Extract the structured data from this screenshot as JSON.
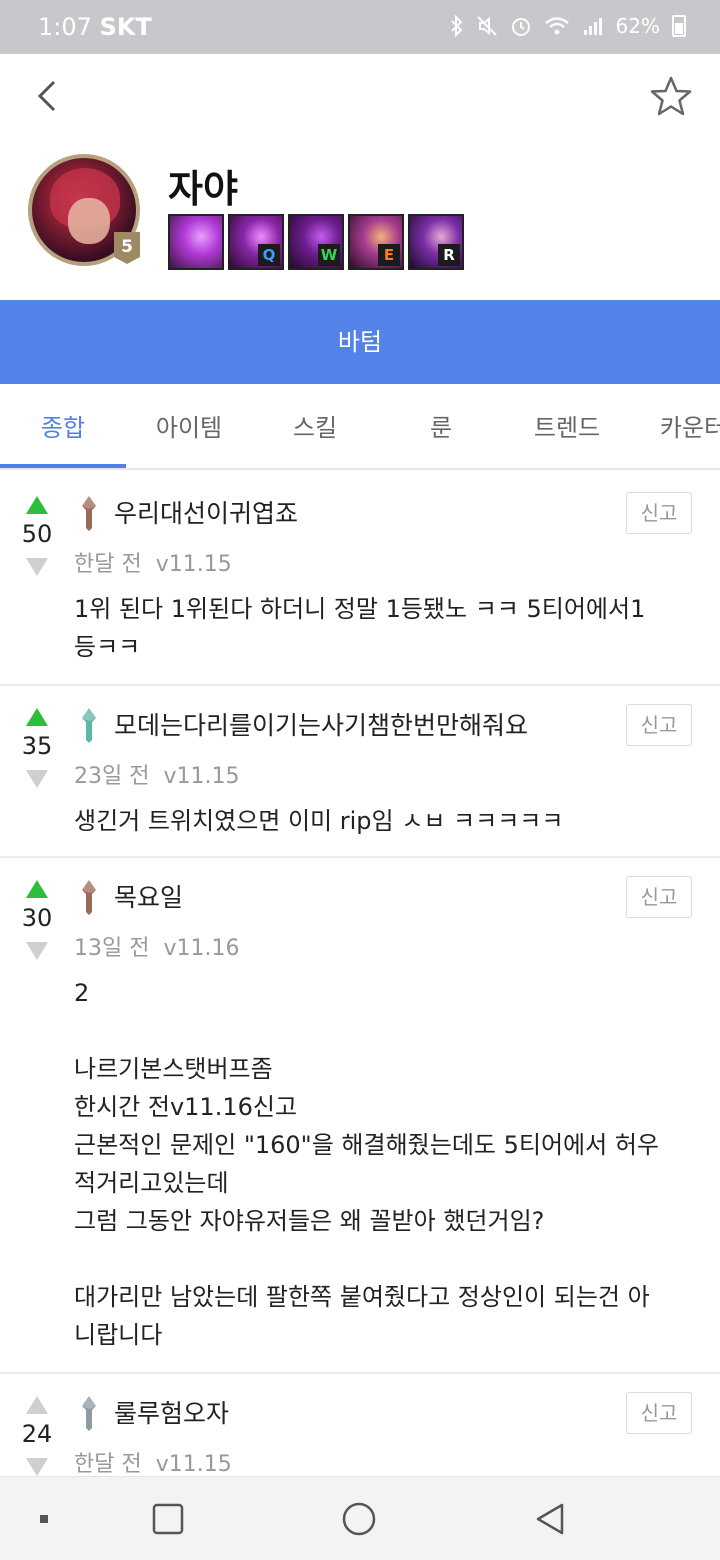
{
  "status_bar": {
    "time": "1:07",
    "carrier": "SKT",
    "battery": "62%"
  },
  "header": {
    "back_icon": "chevron-left-icon",
    "favorite_icon": "star-outline-icon"
  },
  "champion": {
    "name": "자야",
    "level": "5",
    "skills": [
      {
        "key": "",
        "key_color": "",
        "colors": [
          "#3b1640",
          "#b13ad6",
          "#e7a0ff"
        ]
      },
      {
        "key": "Q",
        "key_color": "#3aa0ff",
        "colors": [
          "#2a0b30",
          "#8a27a8",
          "#f08cff"
        ]
      },
      {
        "key": "W",
        "key_color": "#37d45a",
        "colors": [
          "#22092b",
          "#6d1e8e",
          "#c45cf2"
        ]
      },
      {
        "key": "E",
        "key_color": "#ff7a1a",
        "colors": [
          "#2b0e24",
          "#a63c8f",
          "#f2b07a"
        ]
      },
      {
        "key": "R",
        "key_color": "#ffffff",
        "colors": [
          "#1d0a2c",
          "#7b2fa6",
          "#e9a9d6"
        ]
      }
    ]
  },
  "role": "바텀",
  "tabs": [
    "종합",
    "아이템",
    "스킬",
    "룬",
    "트렌드",
    "카운터"
  ],
  "active_tab": "종합",
  "comments": [
    {
      "votes": "50",
      "upvoted": true,
      "tier_color": "#9b6a55",
      "username": "우리대선이귀엽죠",
      "time": "한달 전",
      "version": "v11.15",
      "report": "신고",
      "body": "1위 된다 1위된다 하더니 정말 1등됐노 ㅋㅋ 5티어에서1\n등ㅋㅋ"
    },
    {
      "votes": "35",
      "upvoted": true,
      "tier_color": "#5fb5a8",
      "username": "모데는다리를이기는사기챔한번만해줘요",
      "time": "23일 전",
      "version": "v11.15",
      "report": "신고",
      "body": "생긴거 트위치였으면 이미 rip임 ㅅㅂ ㅋㅋㅋㅋㅋ"
    },
    {
      "votes": "30",
      "upvoted": true,
      "tier_color": "#9b6a55",
      "username": "목요일",
      "time": "13일 전",
      "version": "v11.16",
      "report": "신고",
      "body": "2\n\n나르기본스탯버프좀\n한시간 전v11.16신고\n근본적인 문제인 \"160\"을 해결해줬는데도 5티어에서 허우\n적거리고있는데\n그럼 그동안 자야유저들은 왜 꼴받아 했던거임?\n\n대가리만 남았는데 팔한쪽 붙여줬다고 정상인이 되는건 아\n니랍니다"
    },
    {
      "votes": "24",
      "upvoted": false,
      "tier_color": "#8e9aa6",
      "username": "룰루험오자",
      "time": "한달 전",
      "version": "v11.15",
      "report": "신고",
      "body": ""
    }
  ],
  "nav_bar": {
    "icons": [
      "recent-apps-dot-icon",
      "home-square-icon",
      "home-circle-icon",
      "back-triangle-icon"
    ]
  }
}
